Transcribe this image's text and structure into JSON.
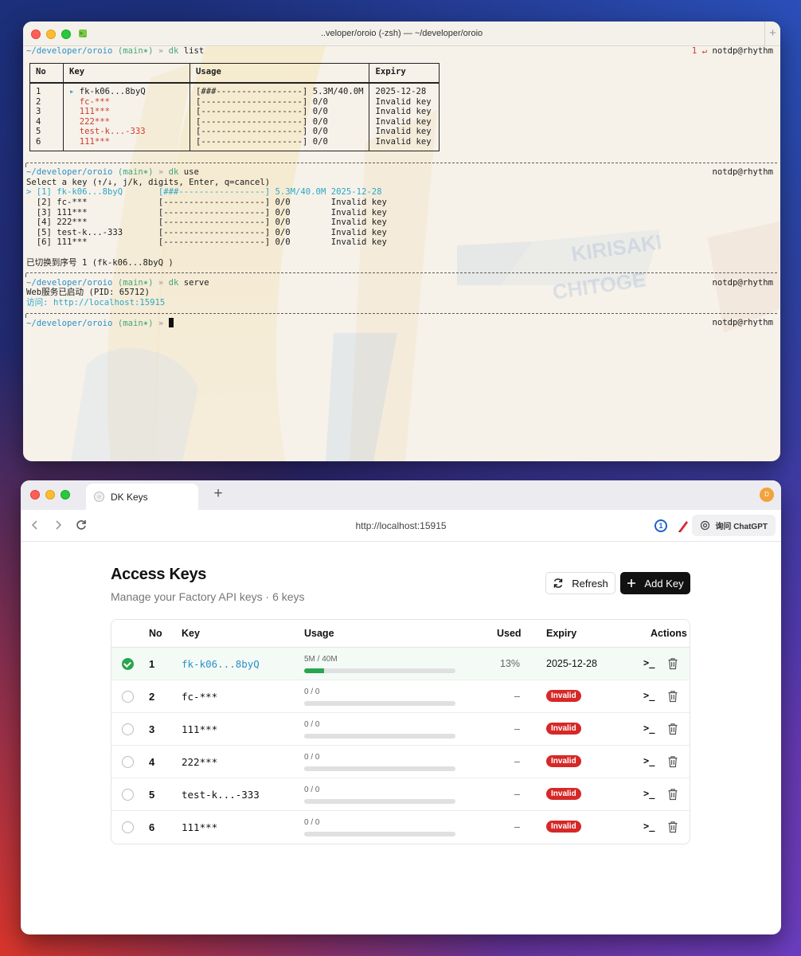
{
  "terminal": {
    "title": "..veloper/oroio (-zsh) — ~/developer/oroio",
    "prompt_path": "~/developer/oroio",
    "prompt_branch": "(main✶)",
    "prompt_arrow": "»",
    "host": "notdp@rhythm",
    "exit_status": "1 ↵",
    "cmd_list": "dk list",
    "cmd_use": "dk use",
    "cmd_serve": "dk serve",
    "list_table": {
      "headers": [
        "No",
        "Key",
        "Usage",
        "Expiry"
      ],
      "rows": [
        {
          "no": "1",
          "marker": "▸",
          "key": "fk-k06...8byQ",
          "usage": "[###-----------------] 5.3M/40.0M",
          "expiry": "2025-12-28"
        },
        {
          "no": "2",
          "marker": " ",
          "key": "fc-***",
          "usage": "[--------------------] 0/0",
          "expiry": "Invalid key"
        },
        {
          "no": "3",
          "marker": " ",
          "key": "111***",
          "usage": "[--------------------] 0/0",
          "expiry": "Invalid key"
        },
        {
          "no": "4",
          "marker": " ",
          "key": "222***",
          "usage": "[--------------------] 0/0",
          "expiry": "Invalid key"
        },
        {
          "no": "5",
          "marker": " ",
          "key": "test-k...-333",
          "usage": "[--------------------] 0/0",
          "expiry": "Invalid key"
        },
        {
          "no": "6",
          "marker": " ",
          "key": "111***",
          "usage": "[--------------------] 0/0",
          "expiry": "Invalid key"
        }
      ]
    },
    "use_prompt": "Select a key (↑/↓, j/k, digits, Enter, q=cancel)",
    "use_rows": [
      {
        "label": "> [1] fk-k06...8byQ",
        "usage": "[###-----------------] 5.3M/40.0M",
        "expiry": "2025-12-28"
      },
      {
        "label": "  [2] fc-***",
        "usage": "[--------------------] 0/0",
        "expiry": "Invalid key"
      },
      {
        "label": "  [3] 111***",
        "usage": "[--------------------] 0/0",
        "expiry": "Invalid key"
      },
      {
        "label": "  [4] 222***",
        "usage": "[--------------------] 0/0",
        "expiry": "Invalid key"
      },
      {
        "label": "  [5] test-k...-333",
        "usage": "[--------------------] 0/0",
        "expiry": "Invalid key"
      },
      {
        "label": "  [6] 111***",
        "usage": "[--------------------] 0/0",
        "expiry": "Invalid key"
      }
    ],
    "switched_msg": "已切换到序号 1 (fk-k06...8byQ )",
    "serve_started": "Web服务已启动 (PID: 65712)",
    "serve_visit": "访问: http://localhost:15915"
  },
  "browser": {
    "tab_title": "DK Keys",
    "url": "http://localhost:15915",
    "profile_initial": "D",
    "chatgpt_label": "询问 ChatGPT",
    "page_title": "Access Keys",
    "subtitle": "Manage your Factory API keys · 6 keys",
    "refresh_label": "Refresh",
    "add_label": "Add Key",
    "columns": [
      "No",
      "Key",
      "Usage",
      "Used",
      "Expiry",
      "Actions"
    ],
    "accent_green": "#2aa44f",
    "invalid_red": "#d62828",
    "rows": [
      {
        "no": "1",
        "key": "fk-k06...8byQ",
        "usage_label": "5M / 40M",
        "usage_fraction": 0.13,
        "used": "13%",
        "expiry": "2025-12-28",
        "status": "active",
        "selected": true
      },
      {
        "no": "2",
        "key": "fc-***",
        "usage_label": "0 / 0",
        "usage_fraction": 0,
        "used": "–",
        "expiry": "Invalid",
        "status": "invalid",
        "selected": false
      },
      {
        "no": "3",
        "key": "111***",
        "usage_label": "0 / 0",
        "usage_fraction": 0,
        "used": "–",
        "expiry": "Invalid",
        "status": "invalid",
        "selected": false
      },
      {
        "no": "4",
        "key": "222***",
        "usage_label": "0 / 0",
        "usage_fraction": 0,
        "used": "–",
        "expiry": "Invalid",
        "status": "invalid",
        "selected": false
      },
      {
        "no": "5",
        "key": "test-k...-333",
        "usage_label": "0 / 0",
        "usage_fraction": 0,
        "used": "–",
        "expiry": "Invalid",
        "status": "invalid",
        "selected": false
      },
      {
        "no": "6",
        "key": "111***",
        "usage_label": "0 / 0",
        "usage_fraction": 0,
        "used": "–",
        "expiry": "Invalid",
        "status": "invalid",
        "selected": false
      }
    ],
    "action_icons": [
      "terminal-icon",
      "trash-icon"
    ]
  }
}
